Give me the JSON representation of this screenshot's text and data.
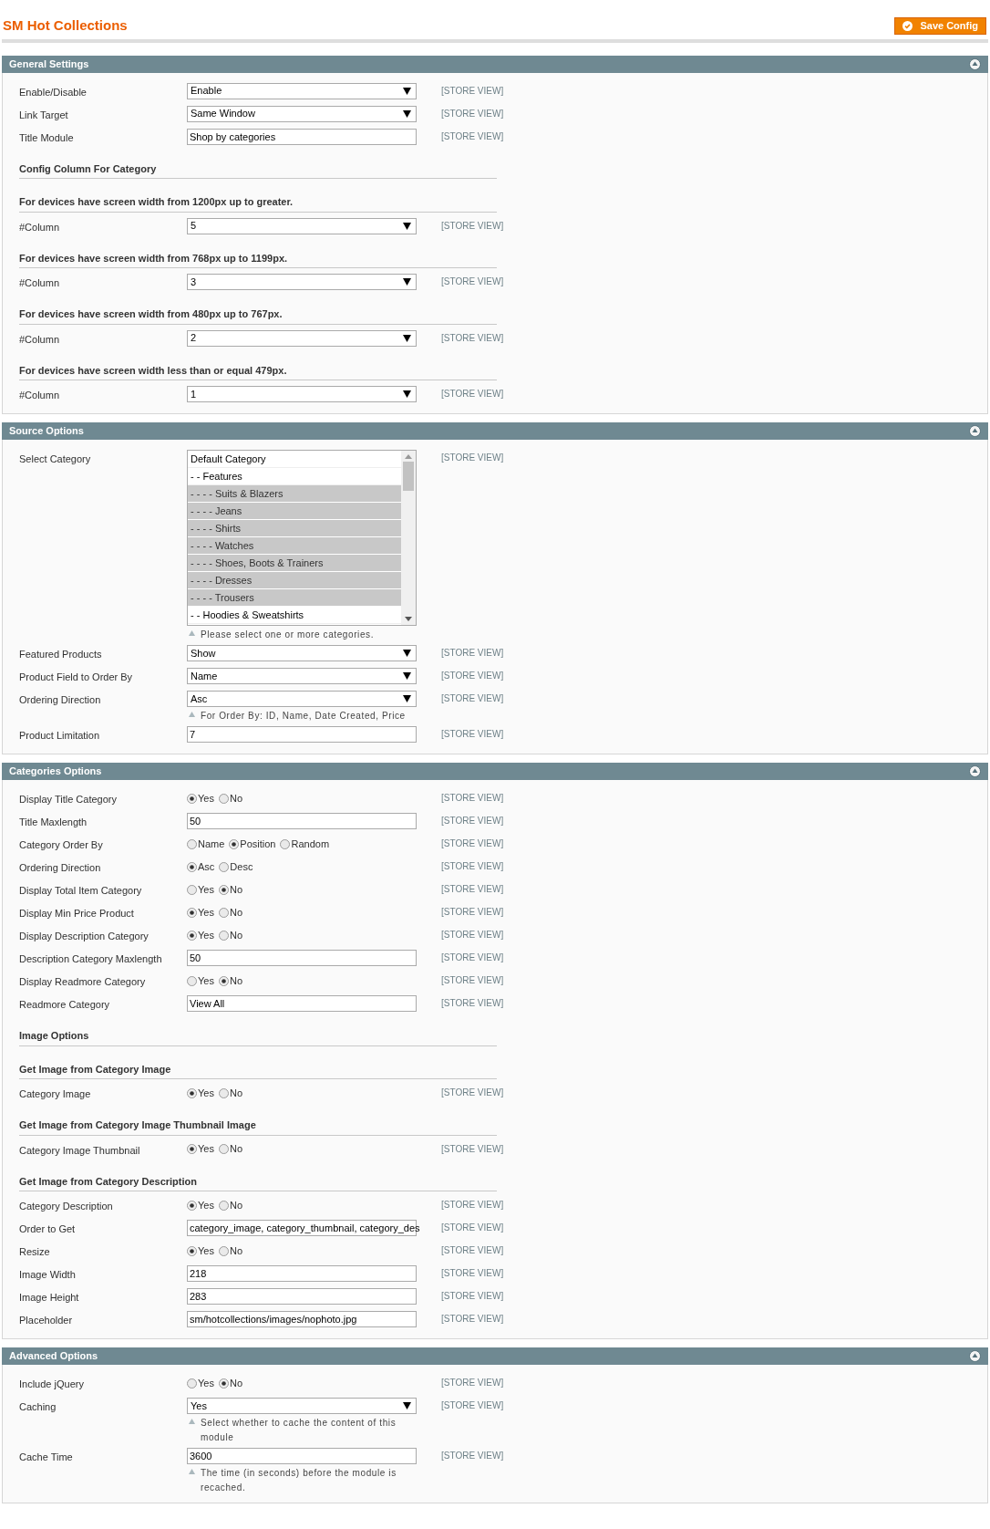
{
  "page": {
    "title": "SM Hot Collections",
    "save_button": "Save Config"
  },
  "sections": [
    {
      "title": "General Settings",
      "items": [
        {
          "kind": "select",
          "label": "Enable/Disable",
          "value": "Enable",
          "scope": "[STORE VIEW]"
        },
        {
          "kind": "select",
          "label": "Link Target",
          "value": "Same Window",
          "scope": "[STORE VIEW]"
        },
        {
          "kind": "text",
          "label": "Title Module",
          "value": "Shop by categories",
          "scope": "[STORE VIEW]"
        },
        {
          "kind": "heading",
          "label": "Config Column For Category"
        },
        {
          "kind": "heading",
          "label": "For devices have screen width from 1200px up to greater."
        },
        {
          "kind": "select",
          "label": "#Column",
          "value": "5",
          "scope": "[STORE VIEW]"
        },
        {
          "kind": "heading",
          "label": "For devices have screen width from 768px up to 1199px."
        },
        {
          "kind": "select",
          "label": "#Column",
          "value": "3",
          "scope": "[STORE VIEW]"
        },
        {
          "kind": "heading",
          "label": "For devices have screen width from 480px up to 767px."
        },
        {
          "kind": "select",
          "label": "#Column",
          "value": "2",
          "scope": "[STORE VIEW]"
        },
        {
          "kind": "heading",
          "label": "For devices have screen width less than or equal 479px."
        },
        {
          "kind": "select",
          "label": "#Column",
          "value": "1",
          "scope": "[STORE VIEW]"
        }
      ]
    },
    {
      "title": "Source Options",
      "items": [
        {
          "kind": "multiselect",
          "label": "Select Category",
          "scope": "[STORE VIEW]",
          "note": "Please select one or more categories.",
          "options": [
            {
              "text": "Default Category",
              "selected": false
            },
            {
              "text": "- - Features",
              "selected": false
            },
            {
              "text": "- - - - Suits & Blazers",
              "selected": true
            },
            {
              "text": "- - - - Jeans",
              "selected": true
            },
            {
              "text": "- - - - Shirts",
              "selected": true
            },
            {
              "text": "- - - - Watches",
              "selected": true
            },
            {
              "text": "- - - - Shoes, Boots & Trainers",
              "selected": true
            },
            {
              "text": "- - - - Dresses",
              "selected": true
            },
            {
              "text": "- - - - Trousers",
              "selected": true
            },
            {
              "text": "- - Hoodies & Sweatshirts",
              "selected": false
            }
          ]
        },
        {
          "kind": "select",
          "label": "Featured Products",
          "value": "Show",
          "scope": "[STORE VIEW]"
        },
        {
          "kind": "select",
          "label": "Product Field to Order By",
          "value": "Name",
          "scope": "[STORE VIEW]"
        },
        {
          "kind": "select",
          "label": "Ordering Direction",
          "value": "Asc",
          "scope": "[STORE VIEW]",
          "note": "For Order By: ID, Name, Date Created, Price"
        },
        {
          "kind": "text",
          "label": "Product Limitation",
          "value": "7",
          "scope": "[STORE VIEW]"
        }
      ]
    },
    {
      "title": "Categories Options",
      "items": [
        {
          "kind": "radio",
          "label": "Display Title Category",
          "scope": "[STORE VIEW]",
          "options": [
            {
              "text": "Yes",
              "selected": true
            },
            {
              "text": "No",
              "selected": false
            }
          ]
        },
        {
          "kind": "text",
          "label": "Title Maxlength",
          "value": "50",
          "scope": "[STORE VIEW]"
        },
        {
          "kind": "radio",
          "label": "Category Order By",
          "scope": "[STORE VIEW]",
          "options": [
            {
              "text": "Name",
              "selected": false
            },
            {
              "text": "Position",
              "selected": true
            },
            {
              "text": "Random",
              "selected": false
            }
          ]
        },
        {
          "kind": "radio",
          "label": "Ordering Direction",
          "scope": "[STORE VIEW]",
          "options": [
            {
              "text": "Asc",
              "selected": true
            },
            {
              "text": "Desc",
              "selected": false
            }
          ]
        },
        {
          "kind": "radio",
          "label": "Display Total Item Category",
          "scope": "[STORE VIEW]",
          "options": [
            {
              "text": "Yes",
              "selected": false
            },
            {
              "text": "No",
              "selected": true
            }
          ]
        },
        {
          "kind": "radio",
          "label": "Display Min Price Product",
          "scope": "[STORE VIEW]",
          "options": [
            {
              "text": "Yes",
              "selected": true
            },
            {
              "text": "No",
              "selected": false
            }
          ]
        },
        {
          "kind": "radio",
          "label": "Display Description Category",
          "scope": "[STORE VIEW]",
          "options": [
            {
              "text": "Yes",
              "selected": true
            },
            {
              "text": "No",
              "selected": false
            }
          ]
        },
        {
          "kind": "text",
          "label": "Description Category Maxlength",
          "value": "50",
          "scope": "[STORE VIEW]"
        },
        {
          "kind": "radio",
          "label": "Display Readmore Category",
          "scope": "[STORE VIEW]",
          "options": [
            {
              "text": "Yes",
              "selected": false
            },
            {
              "text": "No",
              "selected": true
            }
          ]
        },
        {
          "kind": "text",
          "label": "Readmore Category",
          "value": "View All",
          "scope": "[STORE VIEW]"
        },
        {
          "kind": "heading",
          "label": "Image Options"
        },
        {
          "kind": "heading",
          "label": "Get Image from Category Image"
        },
        {
          "kind": "radio",
          "label": "Category Image",
          "scope": "[STORE VIEW]",
          "options": [
            {
              "text": "Yes",
              "selected": true
            },
            {
              "text": "No",
              "selected": false
            }
          ]
        },
        {
          "kind": "heading",
          "label": "Get Image from Category Image Thumbnail Image"
        },
        {
          "kind": "radio",
          "label": "Category Image Thumbnail",
          "scope": "[STORE VIEW]",
          "options": [
            {
              "text": "Yes",
              "selected": true
            },
            {
              "text": "No",
              "selected": false
            }
          ]
        },
        {
          "kind": "heading",
          "label": "Get Image from Category Description"
        },
        {
          "kind": "radio",
          "label": "Category Description",
          "scope": "[STORE VIEW]",
          "options": [
            {
              "text": "Yes",
              "selected": true
            },
            {
              "text": "No",
              "selected": false
            }
          ]
        },
        {
          "kind": "text",
          "label": "Order to Get",
          "value": "category_image, category_thumbnail, category_des",
          "scope": "[STORE VIEW]"
        },
        {
          "kind": "radio",
          "label": "Resize",
          "scope": "[STORE VIEW]",
          "options": [
            {
              "text": "Yes",
              "selected": true
            },
            {
              "text": "No",
              "selected": false
            }
          ]
        },
        {
          "kind": "text",
          "label": "Image Width",
          "value": "218",
          "scope": "[STORE VIEW]"
        },
        {
          "kind": "text",
          "label": "Image Height",
          "value": "283",
          "scope": "[STORE VIEW]"
        },
        {
          "kind": "text",
          "label": "Placeholder",
          "value": "sm/hotcollections/images/nophoto.jpg",
          "scope": "[STORE VIEW]"
        }
      ]
    },
    {
      "title": "Advanced Options",
      "items": [
        {
          "kind": "radio",
          "label": "Include jQuery",
          "scope": "[STORE VIEW]",
          "options": [
            {
              "text": "Yes",
              "selected": false
            },
            {
              "text": "No",
              "selected": true
            }
          ]
        },
        {
          "kind": "select",
          "label": "Caching",
          "value": "Yes",
          "scope": "[STORE VIEW]",
          "note": "Select whether to cache the content of this module"
        },
        {
          "kind": "text",
          "label": "Cache Time",
          "value": "3600",
          "scope": "[STORE VIEW]",
          "note": "The time (in seconds) before the module is recached."
        }
      ]
    }
  ]
}
